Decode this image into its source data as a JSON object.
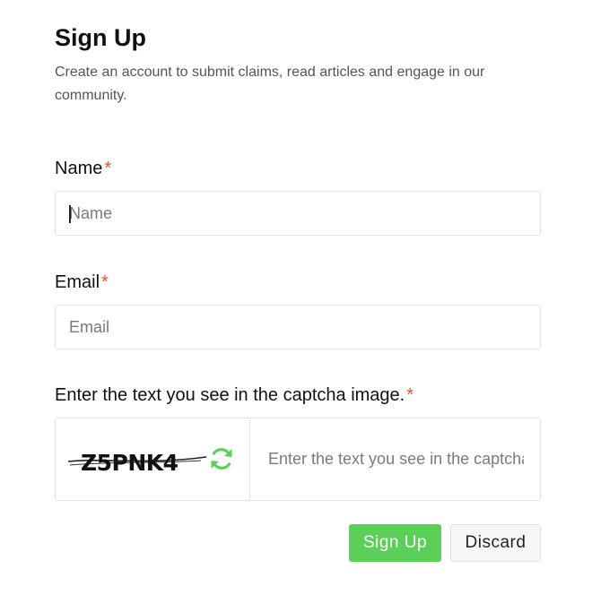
{
  "header": {
    "title": "Sign Up",
    "subtitle": "Create an account to submit claims, read articles and engage in our community."
  },
  "form": {
    "required_mark": "*",
    "name": {
      "label": "Name",
      "placeholder": "Name",
      "value": ""
    },
    "email": {
      "label": "Email",
      "placeholder": "Email",
      "value": ""
    },
    "captcha": {
      "label": "Enter the text you see in the captcha image.",
      "image_text": "Z5PNK4",
      "placeholder": "Enter the text you see in the captcha image.",
      "value": "",
      "refresh_icon": "refresh-icon"
    }
  },
  "actions": {
    "submit_label": "Sign Up",
    "discard_label": "Discard"
  },
  "colors": {
    "accent": "#5ccf5a",
    "required": "#e0522d",
    "subtitle": "#555555",
    "border": "#e2e2e2"
  }
}
